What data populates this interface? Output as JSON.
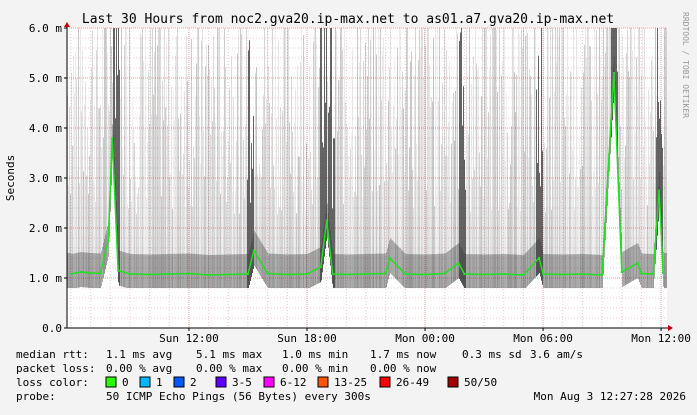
{
  "chart_data": {
    "type": "line",
    "title": "Last 30 Hours from noc2.gva20.ip-max.net to as01.a7.gva20.ip-max.net",
    "ylabel": "Seconds",
    "watermark": "RRDTOOL / TOBI OETIKER",
    "y_ticks": [
      "0.0",
      "1.0 m",
      "2.0 m",
      "3.0 m",
      "4.0 m",
      "5.0 m",
      "6.0 m"
    ],
    "ylim": [
      0,
      0.006
    ],
    "x_ticks": [
      "Sun 12:00",
      "Sun 18:00",
      "Mon 00:00",
      "Mon 06:00",
      "Mon 12:00"
    ],
    "x_tick_hours": [
      6,
      12,
      18,
      24,
      30
    ],
    "xlim_hours": [
      -0.2,
      30.3
    ],
    "grid": true,
    "colors": {
      "background": "#f3f3f3",
      "plot": "#ffffff",
      "grid_minor": "#f0c8c8",
      "grid_major": "#e8a0a0",
      "median_line": "#20e020",
      "smoke": "#303030",
      "axis": "#000000"
    },
    "series": [
      {
        "name": "median rtt",
        "x": [
          0,
          0.5,
          1,
          1.5,
          1.9,
          2.1,
          2.4,
          3,
          4,
          5,
          6,
          7,
          8,
          9,
          9.3,
          10,
          11,
          12,
          12.7,
          13,
          13.3,
          14,
          15,
          16,
          16.2,
          17,
          18,
          19,
          19.7,
          20,
          21,
          22,
          23,
          23.8,
          24,
          25,
          26,
          27,
          27.6,
          28,
          28.8,
          29,
          29.6,
          29.9,
          30.1
        ],
        "y": [
          0.00108,
          0.00112,
          0.0011,
          0.00109,
          0.00175,
          0.0038,
          0.00115,
          0.00108,
          0.00107,
          0.00108,
          0.00109,
          0.00106,
          0.00107,
          0.00108,
          0.00155,
          0.00109,
          0.00107,
          0.00108,
          0.00122,
          0.00215,
          0.00108,
          0.00107,
          0.00108,
          0.00109,
          0.0014,
          0.00108,
          0.00107,
          0.00109,
          0.0013,
          0.00108,
          0.00107,
          0.00108,
          0.00106,
          0.0014,
          0.00108,
          0.00107,
          0.00108,
          0.00106,
          0.0051,
          0.00112,
          0.0013,
          0.00109,
          0.00108,
          0.00275,
          0.0011
        ]
      }
    ]
  },
  "legend": {
    "median_rtt": {
      "label": "median rtt:",
      "avg": "1.1 ms avg",
      "max": "5.1 ms max",
      "min": "1.0 ms min",
      "now": "1.7 ms now",
      "sd": "0.3 ms sd",
      "am": "3.6   am/s"
    },
    "packet_loss": {
      "label": "packet loss:",
      "avg": "0.00 % avg",
      "max": "0.00 % max",
      "min": "0.00 % min",
      "now": "0.00 % now"
    },
    "loss_color": {
      "label": "loss color:",
      "items": [
        {
          "label": "0",
          "color": "#26ff00"
        },
        {
          "label": "1",
          "color": "#00b8ff"
        },
        {
          "label": "2",
          "color": "#0059ff"
        },
        {
          "label": "3-5",
          "color": "#5e00ff"
        },
        {
          "label": "6-12",
          "color": "#ff00ff"
        },
        {
          "label": "13-25",
          "color": "#ff5500"
        },
        {
          "label": "26-49",
          "color": "#ff0000"
        },
        {
          "label": "50/50",
          "color": "#a10000"
        }
      ]
    },
    "probe": {
      "label": "probe:",
      "text": "50 ICMP Echo Pings (56 Bytes) every 300s",
      "timestamp": "Mon Aug  3 12:27:28 2026"
    }
  }
}
